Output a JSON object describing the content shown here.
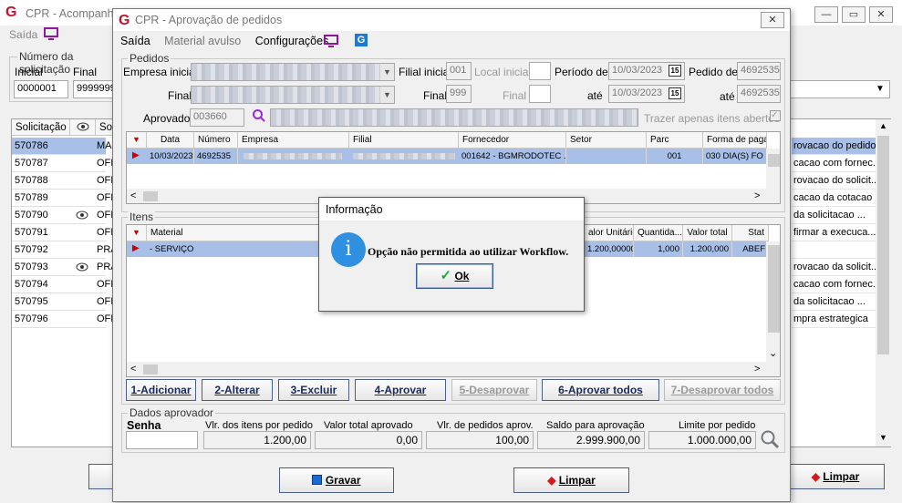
{
  "bg_window": {
    "title": "CPR - Acompanha",
    "menu_saida": "Saída",
    "group_label": "Número da solicitação",
    "inicial_label": "Inicial",
    "final_label": "Final",
    "inicial_value": "0000001",
    "final_value": "9999999",
    "list_headers": [
      "Solicitação",
      "Soli"
    ],
    "rows": [
      {
        "id": "570786",
        "code": "MAI",
        "eye": false,
        "right": "rovacao do pedido",
        "selected": true
      },
      {
        "id": "570787",
        "code": "OFI",
        "eye": false,
        "right": "cacao com fornec...",
        "selected": false
      },
      {
        "id": "570788",
        "code": "OFI",
        "eye": false,
        "right": "rovacao do solicit...",
        "selected": false
      },
      {
        "id": "570789",
        "code": "OFI",
        "eye": false,
        "right": "cacao da cotacao",
        "selected": false
      },
      {
        "id": "570790",
        "code": "OFI",
        "eye": true,
        "right": "da solicitacao ...",
        "selected": false
      },
      {
        "id": "570791",
        "code": "OFI",
        "eye": false,
        "right": "firmar a execuca...",
        "selected": false
      },
      {
        "id": "570792",
        "code": "PRA",
        "eye": false,
        "right": "",
        "selected": false
      },
      {
        "id": "570793",
        "code": "PRA",
        "eye": true,
        "right": "rovacao da solicit...",
        "selected": false
      },
      {
        "id": "570794",
        "code": "OFI",
        "eye": false,
        "right": "cacao com fornec...",
        "selected": false
      },
      {
        "id": "570795",
        "code": "OFI",
        "eye": false,
        "right": "da solicitacao ...",
        "selected": false
      },
      {
        "id": "570796",
        "code": "OFI",
        "eye": false,
        "right": "mpra estrategica",
        "selected": false
      }
    ],
    "limpar_label": "Limpar"
  },
  "dialog": {
    "title": "CPR - Aprovação de pedidos",
    "menu": [
      "Saída",
      "Material avulso",
      "Configurações"
    ],
    "pedidos_legend": "Pedidos",
    "empresa_inicial_label": "Empresa inicial",
    "filial_inicial_label": "Filial inicial",
    "filial_inicial_value": "001",
    "local_inicial_label": "Local inicial",
    "periodo_label": "Período de",
    "periodo_de": "10/03/2023",
    "pedido_de_label": "Pedido de",
    "pedido_de_value": "4692535",
    "final_label": "Final",
    "filial_final_value": "999",
    "local_final_label": "Final",
    "ate_label": "até",
    "periodo_ate": "10/03/2023",
    "pedido_ate_value": "4692535",
    "aprovador_label": "Aprovador",
    "aprovador_value": "003660",
    "trazer_label": "Trazer apenas itens abertos",
    "cal_glyph": "15",
    "pedidos_headers": [
      "Data",
      "Número",
      "Empresa",
      "Filial",
      "Fornecedor",
      "Setor",
      "Parc",
      "Forma de paga"
    ],
    "pedido_row": {
      "data": "10/03/2023",
      "numero": "4692535",
      "fornecedor": "001642 - BGMRODOTEC ...",
      "parc": "001",
      "forma": "030 DIA(S) FO"
    },
    "itens_legend": "Itens",
    "itens_headers": [
      "Material",
      "alor Unitário",
      "Quantida...",
      "Valor total",
      "Stat"
    ],
    "item_row": {
      "material": "- SERVIÇO",
      "valor_unit": "1.200,000000",
      "qtd": "1,000",
      "total": "1.200,000",
      "status": "ABEF"
    },
    "buttons": [
      {
        "label": "1-Adicionar",
        "enabled": true
      },
      {
        "label": "2-Alterar",
        "enabled": true
      },
      {
        "label": "3-Excluir",
        "enabled": true
      },
      {
        "label": "4-Aprovar",
        "enabled": true
      },
      {
        "label": "5-Desaprovar",
        "enabled": false
      },
      {
        "label": "6-Aprovar todos",
        "enabled": true
      },
      {
        "label": "7-Desaprovar todos",
        "enabled": false
      }
    ],
    "dados_legend": "Dados aprovador",
    "senha_label": "Senha",
    "vlr_itens_label": "Vlr. dos itens por pedido",
    "vlr_itens_value": "1.200,00",
    "valor_total_label": "Valor total aprovado",
    "valor_total_value": "0,00",
    "vlr_pedidos_label": "Vlr. de pedidos aprov.",
    "vlr_pedidos_value": "100,00",
    "saldo_label": "Saldo para aprovação",
    "saldo_value": "2.999.900,00",
    "limite_label": "Limite por pedido",
    "limite_value": "1.000.000,00",
    "gravar_label": "Gravar",
    "limpar_label": "Limpar"
  },
  "message_box": {
    "title": "Informação",
    "icon_glyph": "i",
    "message": "Opção não permitida ao utilizar Workflow.",
    "ok_label": "Ok"
  },
  "colors": {
    "accent": "#c8102e",
    "selection": "#a8bfe8",
    "info_icon": "#2f8fe0"
  }
}
